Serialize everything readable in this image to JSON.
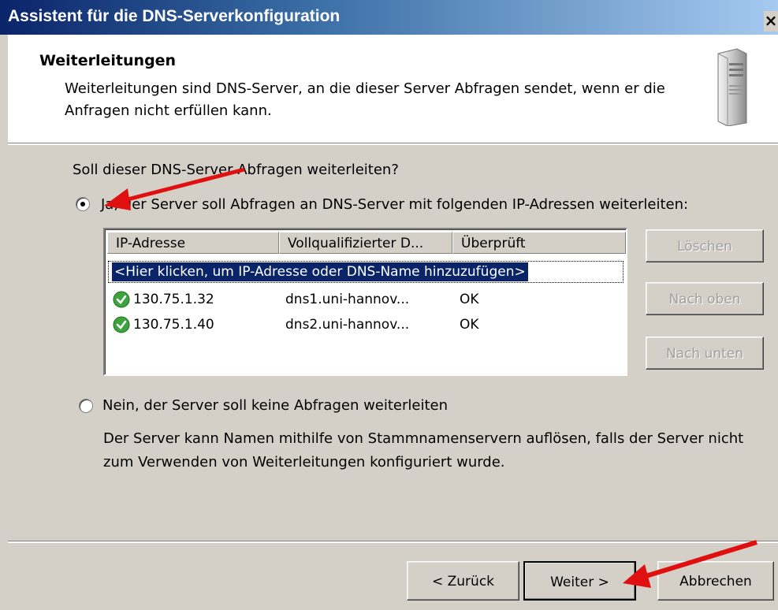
{
  "window": {
    "title": "Assistent für die DNS-Serverkonfiguration",
    "close_glyph": "×"
  },
  "header": {
    "title": "Weiterleitungen",
    "description": "Weiterleitungen sind DNS-Server, an die dieser Server Abfragen sendet, wenn er die Anfragen nicht erfüllen kann.",
    "icon": "server-icon"
  },
  "question": "Soll dieser DNS-Server Abfragen weiterleiten?",
  "option_yes": {
    "label": "Ja, der Server soll Abfragen an DNS-Server mit folgenden IP-Adressen weiterleiten:",
    "selected": true
  },
  "forwarders_list": {
    "columns": [
      "IP-Adresse",
      "Vollqualifizierter D...",
      "Überprüft"
    ],
    "add_prompt": "<Hier klicken, um IP-Adresse oder DNS-Name hinzuzufügen>",
    "rows": [
      {
        "ip": "130.75.1.32",
        "fqdn": "dns1.uni-hannov...",
        "status": "OK",
        "icon": "check-ok-icon"
      },
      {
        "ip": "130.75.1.40",
        "fqdn": "dns2.uni-hannov...",
        "status": "OK",
        "icon": "check-ok-icon"
      }
    ]
  },
  "side_buttons": {
    "delete": "Löschen",
    "up": "Nach oben",
    "down": "Nach unten"
  },
  "option_no": {
    "label": "Nein, der Server soll keine Abfragen weiterleiten",
    "description": "Der Server kann Namen mithilfe von Stammnamenservern auflösen, falls der Server nicht zum Verwenden von Weiterleitungen konfiguriert wurde.",
    "selected": false
  },
  "footer": {
    "back": "< Zurück",
    "next": "Weiter >",
    "cancel": "Abbrechen"
  },
  "annotation_color": "#e01010"
}
